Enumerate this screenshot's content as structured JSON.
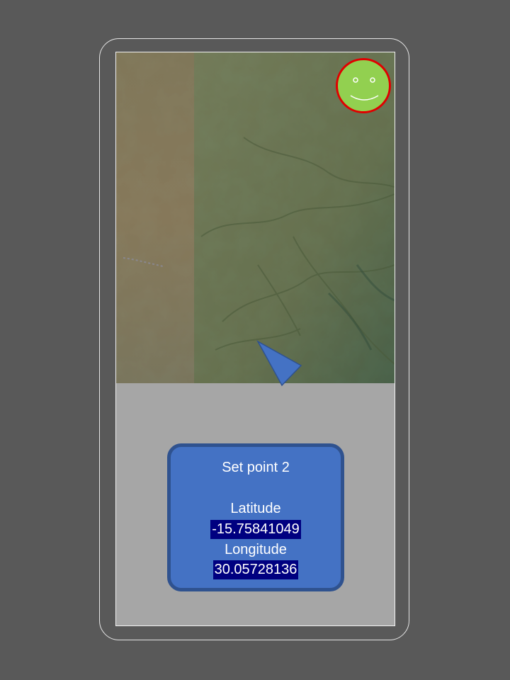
{
  "dialog": {
    "title": "Set point 2",
    "latitude_label": "Latitude",
    "latitude_value": "-15.75841049",
    "longitude_label": "Longitude",
    "longitude_value": "30.05728136"
  },
  "colors": {
    "background": "#595959",
    "screen": "#a6a6a6",
    "dialog_fill": "#4472c4",
    "dialog_border": "#2f528f",
    "value_highlight": "#000080",
    "avatar_fill": "#92d050",
    "avatar_ring": "#e00000",
    "pointer": "#4472c4"
  },
  "icons": {
    "avatar": "smiley-face-icon",
    "location_pointer": "triangle-pointer-icon"
  }
}
